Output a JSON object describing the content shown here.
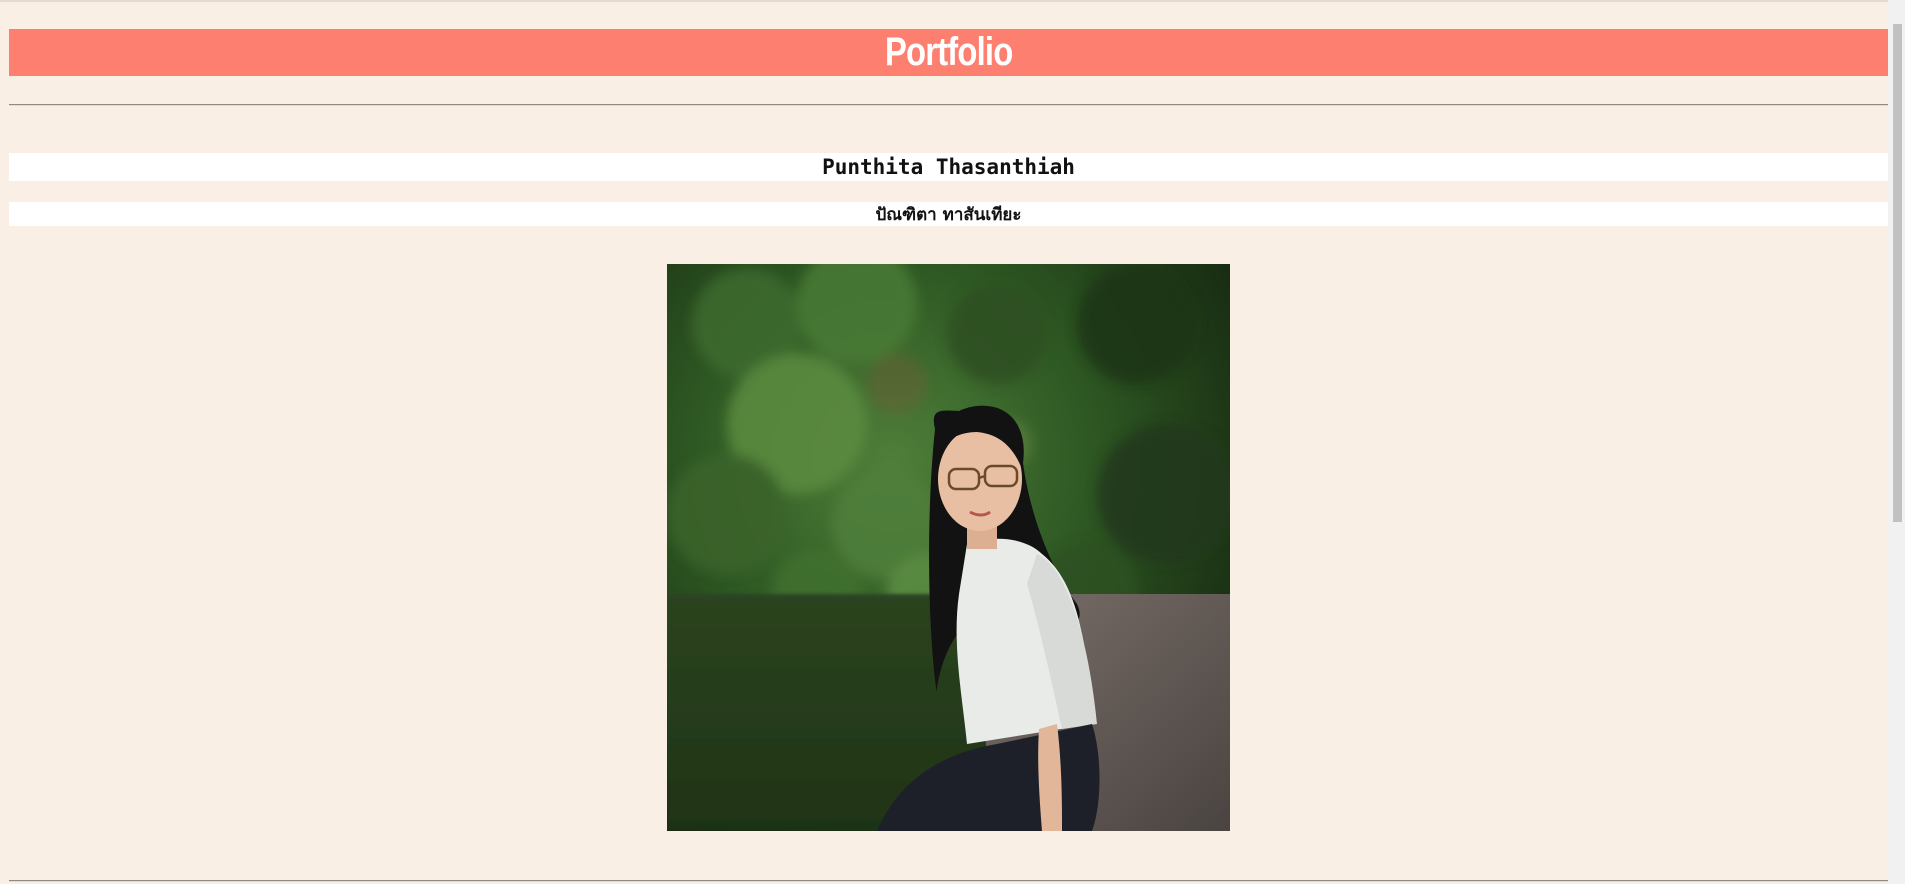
{
  "header": {
    "title": "Portfolio"
  },
  "profile": {
    "name_en": "Punthita Thasanthiah",
    "name_th": "ปัณฑิตา ทาสันเทียะ"
  },
  "photo": {
    "subject": "portrait-photo"
  },
  "colors": {
    "page_background": "#faefe5",
    "banner": "#fd7f6f",
    "banner_text": "#ffffff",
    "name_background": "#ffffff"
  }
}
